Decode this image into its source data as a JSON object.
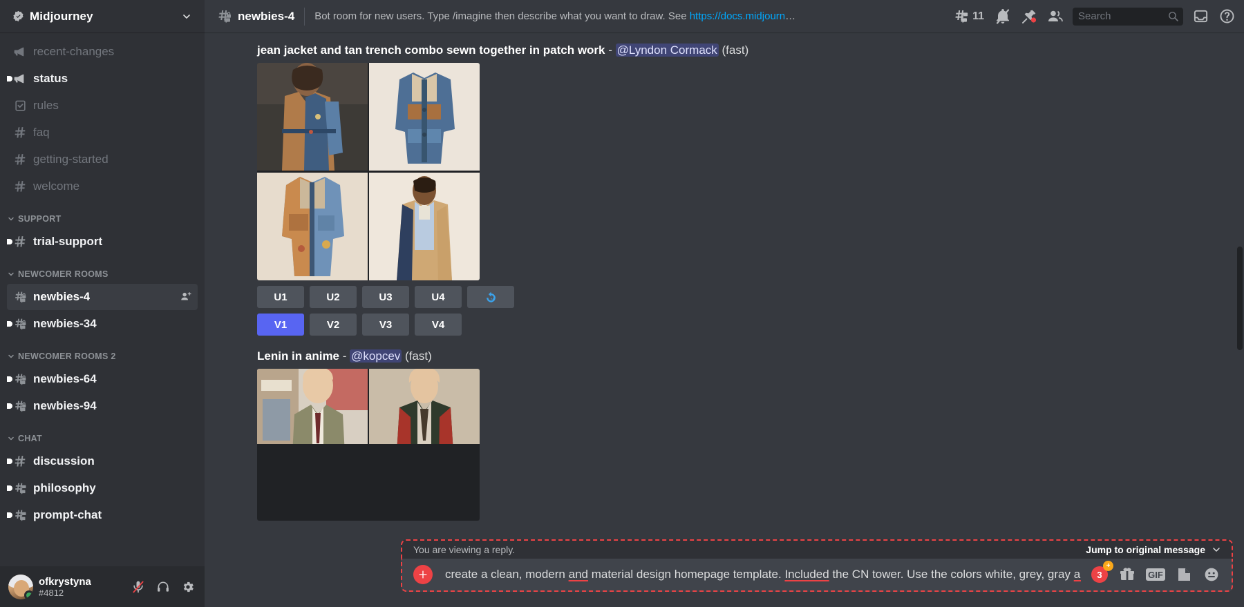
{
  "sidebar": {
    "server": {
      "name": "Midjourney",
      "verified_icon": "verified-badge-icon",
      "chevron_icon": "chevron-down-icon"
    },
    "groups": [
      {
        "label": "",
        "channels": [
          {
            "name": "recent-changes",
            "icon": "announcement-icon",
            "state": "muted"
          },
          {
            "name": "status",
            "icon": "announcement-icon",
            "state": "unread"
          },
          {
            "name": "rules",
            "icon": "rules-icon",
            "state": "muted"
          },
          {
            "name": "faq",
            "icon": "hash-icon",
            "state": "muted"
          },
          {
            "name": "getting-started",
            "icon": "hash-icon",
            "state": "muted"
          },
          {
            "name": "welcome",
            "icon": "hash-icon",
            "state": "muted"
          }
        ]
      },
      {
        "label": "SUPPORT",
        "channels": [
          {
            "name": "trial-support",
            "icon": "hash-icon",
            "state": "unread"
          }
        ]
      },
      {
        "label": "NEWCOMER ROOMS",
        "channels": [
          {
            "name": "newbies-4",
            "icon": "hash-thread-locked-icon",
            "state": "active",
            "trailing_icon": "add-member-icon"
          },
          {
            "name": "newbies-34",
            "icon": "hash-thread-locked-icon",
            "state": "unread"
          }
        ]
      },
      {
        "label": "NEWCOMER ROOMS 2",
        "channels": [
          {
            "name": "newbies-64",
            "icon": "hash-thread-locked-icon",
            "state": "unread"
          },
          {
            "name": "newbies-94",
            "icon": "hash-thread-locked-icon",
            "state": "unread"
          }
        ]
      },
      {
        "label": "CHAT",
        "channels": [
          {
            "name": "discussion",
            "icon": "hash-icon",
            "state": "unread"
          },
          {
            "name": "philosophy",
            "icon": "hash-thread-icon",
            "state": "unread"
          },
          {
            "name": "prompt-chat",
            "icon": "hash-thread-icon",
            "state": "unread"
          }
        ]
      }
    ],
    "user": {
      "name": "ofkrystyna",
      "tag": "#4812",
      "status": "online",
      "mute_icon": "mic-muted-icon",
      "deafen_icon": "headphones-icon",
      "settings_icon": "gear-icon"
    }
  },
  "topbar": {
    "channel_icon": "hash-thread-locked-icon",
    "channel_name": "newbies-4",
    "topic_text": "Bot room for new users. Type /imagine then describe what you want to draw. See ",
    "topic_link": "https://docs.midjourney....",
    "threads_icon": "threads-icon",
    "threads_count": "11",
    "notifications_icon": "bell-muted-icon",
    "pinned_icon": "pin-icon",
    "members_icon": "members-icon",
    "search": {
      "placeholder": "Search",
      "value": "",
      "icon": "search-icon"
    },
    "inbox_icon": "inbox-icon",
    "help_icon": "help-circle-icon"
  },
  "messages": [
    {
      "prompt": "jean jacket and tan trench combo sewn together in patch work",
      "separator": "-",
      "author": "@Lyndon Cormack",
      "mode": "(fast)",
      "upscale_buttons": [
        "U1",
        "U2",
        "U3",
        "U4"
      ],
      "reroll_button_icon": "reroll-icon",
      "variation_buttons": [
        "V1",
        "V2",
        "V3",
        "V4"
      ],
      "active_variation": "V1"
    },
    {
      "prompt": "Lenin in anime",
      "separator": "-",
      "author": "@kopcev",
      "mode": "(fast)"
    }
  ],
  "composer": {
    "reply_notice": "You are viewing a reply.",
    "jump_label": "Jump to original message",
    "jump_chevron_icon": "chevron-down-icon",
    "plus_button_icon": "plus-icon",
    "text_value": "create a clean, modern and material design homepage template. Included the CN tower. Use the colors white, grey, gray and gold.",
    "spellcheck_words": [
      "and",
      "Included",
      "and"
    ],
    "nitro_badge_count": "3",
    "gift_icon": "gift-icon",
    "gif_label": "GIF",
    "sticker_icon": "sticker-icon",
    "emoji_icon": "emoji-icon"
  },
  "colors": {
    "accent": "#5865f2",
    "danger": "#ed4245",
    "online": "#3ba55d",
    "link": "#00a8fc",
    "sidebar_bg": "#2f3136",
    "main_bg": "#36393f"
  }
}
